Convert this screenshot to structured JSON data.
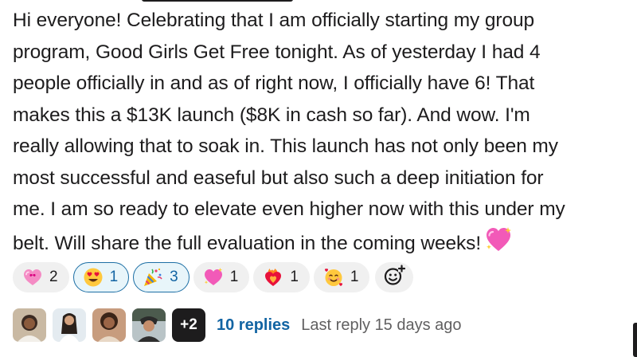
{
  "message": {
    "lines": [
      "Hi everyone! Celebrating that I am officially starting my group",
      "program, Good Girls Get Free tonight. As of yesterday I had 4",
      "people officially in and as of right now, I officially have 6! That",
      "makes this a $13K launch ($8K in cash so far). And wow. I'm",
      "really allowing that to soak in. This launch has not only been my",
      "most successful and easeful but also such a deep initiation for",
      "me. I am so ready to elevate even higher now with this under my",
      "belt. Will share the full evaluation in the coming weeks!"
    ],
    "trailing_emoji": "sparkling-heart-icon"
  },
  "reactions": [
    {
      "emoji": "heart-with-ribbon-icon",
      "count": "2",
      "active": false
    },
    {
      "emoji": "heart-eyes-icon",
      "count": "1",
      "active": true
    },
    {
      "emoji": "party-popper-icon",
      "count": "3",
      "active": true
    },
    {
      "emoji": "sparkling-heart-icon",
      "count": "1",
      "active": false
    },
    {
      "emoji": "heart-on-fire-icon",
      "count": "1",
      "active": false
    },
    {
      "emoji": "smiling-face-with-hearts-icon",
      "count": "1",
      "active": false
    }
  ],
  "add_reaction_icon": "add-reaction-icon",
  "thread": {
    "more_count": "+2",
    "replies": "10 replies",
    "last_reply": "Last reply 15 days ago"
  },
  "colors": {
    "link": "#1264a3",
    "active_border": "#1d6fa5",
    "active_bg": "#e8f5fa",
    "pill_bg": "#f0f0f0",
    "muted": "#616061"
  }
}
